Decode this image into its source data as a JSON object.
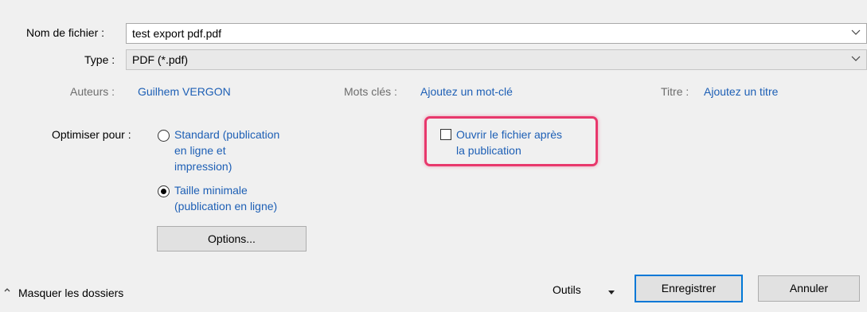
{
  "filename": {
    "label": "Nom de fichier :",
    "value": "test export pdf.pdf"
  },
  "type": {
    "label": "Type :",
    "value": "PDF (*.pdf)"
  },
  "metadata": {
    "authors_label": "Auteurs :",
    "authors_value": "Guilhem VERGON",
    "keywords_label": "Mots clés :",
    "keywords_value": "Ajoutez un mot-clé",
    "title_label": "Titre :",
    "title_value": "Ajoutez un titre"
  },
  "optimize": {
    "label": "Optimiser pour :",
    "options": [
      {
        "lines": [
          "Standard (publication",
          "en ligne et",
          "impression)"
        ],
        "selected": false
      },
      {
        "lines": [
          "Taille minimale",
          "(publication en ligne)"
        ],
        "selected": true
      }
    ],
    "options_button": "Options..."
  },
  "open_after": {
    "lines": [
      "Ouvrir le fichier après",
      "la publication"
    ],
    "checked": false
  },
  "footer": {
    "hide_folders": "Masquer les dossiers",
    "tools": "Outils",
    "save": "Enregistrer",
    "cancel": "Annuler"
  },
  "colors": {
    "link": "#1d5fb5",
    "highlight": "#e8386c",
    "primary_border": "#0078d7"
  }
}
